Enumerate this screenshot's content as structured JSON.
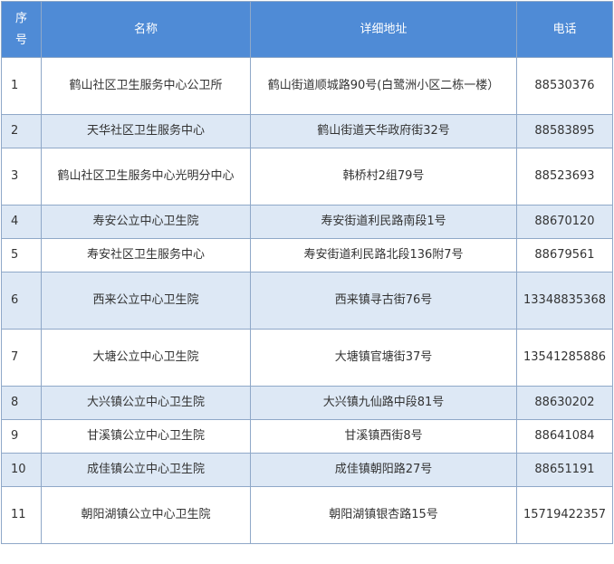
{
  "table": {
    "headers": {
      "index": "序号",
      "name": "名称",
      "address": "详细地址",
      "phone": "电话"
    },
    "rows": [
      {
        "index": "1",
        "name": "鹤山社区卫生服务中心公卫所",
        "address": "鹤山街道顺城路90号(白鹭洲小区二栋一楼）",
        "phone": "88530376"
      },
      {
        "index": "2",
        "name": "天华社区卫生服务中心",
        "address": "鹤山街道天华政府街32号",
        "phone": "88583895"
      },
      {
        "index": "3",
        "name": "鹤山社区卫生服务中心光明分中心",
        "address": "韩桥村2组79号",
        "phone": "88523693"
      },
      {
        "index": "4",
        "name": "寿安公立中心卫生院",
        "address": "寿安街道利民路南段1号",
        "phone": "88670120"
      },
      {
        "index": "5",
        "name": "寿安社区卫生服务中心",
        "address": "寿安街道利民路北段136附7号",
        "phone": "88679561"
      },
      {
        "index": "6",
        "name": "西来公立中心卫生院",
        "address": "西来镇寻古街76号",
        "phone": "13348835368"
      },
      {
        "index": "7",
        "name": "大塘公立中心卫生院",
        "address": "大塘镇官塘街37号",
        "phone": "13541285886"
      },
      {
        "index": "8",
        "name": "大兴镇公立中心卫生院",
        "address": "大兴镇九仙路中段81号",
        "phone": "88630202"
      },
      {
        "index": "9",
        "name": "甘溪镇公立中心卫生院",
        "address": "甘溪镇西街8号",
        "phone": "88641084"
      },
      {
        "index": "10",
        "name": "成佳镇公立中心卫生院",
        "address": "成佳镇朝阳路27号",
        "phone": "88651191"
      },
      {
        "index": "11",
        "name": "朝阳湖镇公立中心卫生院",
        "address": "朝阳湖镇银杏路15号",
        "phone": "15719422357"
      }
    ]
  },
  "colors": {
    "header_bg": "#4f8bd6",
    "header_text": "#ffffff",
    "alt_row_bg": "#dde8f5",
    "border": "#8fa8c8"
  }
}
